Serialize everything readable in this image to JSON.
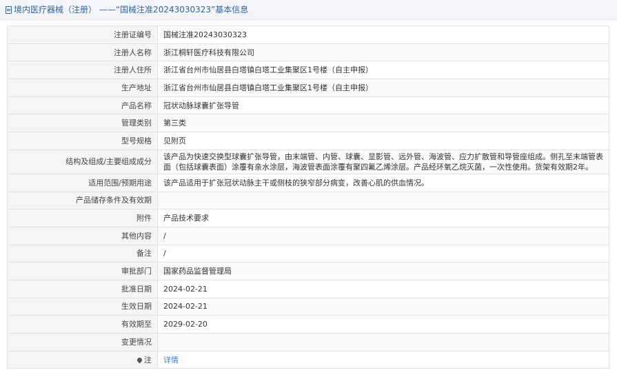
{
  "header": {
    "title": "境内医疗器械（注册）",
    "separator": "——",
    "subtitle": "“国械注准20243030323”基本信息"
  },
  "rows": [
    {
      "label": "注册证编号",
      "value": "国械注准20243030323"
    },
    {
      "label": "注册人名称",
      "value": "浙江桐轩医疗科技有限公司"
    },
    {
      "label": "注册人住所",
      "value": "浙江省台州市仙居县白塔镇白塔工业集聚区1号楼（自主申报）"
    },
    {
      "label": "生产地址",
      "value": "浙江省台州市仙居县白塔镇白塔工业集聚区1号楼（自主申报）"
    },
    {
      "label": "产品名称",
      "value": "冠状动脉球囊扩张导管"
    },
    {
      "label": "管理类别",
      "value": "第三类"
    },
    {
      "label": "型号规格",
      "value": "见附页"
    },
    {
      "label": "结构及组成/主要组成成分",
      "value": "该产品为快速交换型球囊扩张导管，由末端管、内管、球囊、显影管、远外管、海波管、应力扩散管和导管座组成。侧孔至末端管表面（包括球囊表面）涂覆有亲水涂层，海波管表面涂覆有聚四氟乙烯涂层。产品经环氧乙烷灭菌，一次性使用。货架有效期2年。"
    },
    {
      "label": "适用范围/预期用途",
      "value": "该产品适用于扩张冠状动脉主干或侧枝的狭窄部分病变，改善心肌的供血情况。"
    },
    {
      "label": "产品储存条件及有效期",
      "value": ""
    },
    {
      "label": "附件",
      "value": "产品技术要求"
    },
    {
      "label": "其他内容",
      "value": "/"
    },
    {
      "label": "备注",
      "value": "/"
    },
    {
      "label": "审批部门",
      "value": "国家药品监督管理局"
    },
    {
      "label": "批准日期",
      "value": "2024-02-21"
    },
    {
      "label": "生效日期",
      "value": "2024-02-21"
    },
    {
      "label": "有效期至",
      "value": "2029-02-20"
    },
    {
      "label": "变更情况",
      "value": ""
    }
  ],
  "note": {
    "label": "注",
    "link_text": "详情"
  }
}
